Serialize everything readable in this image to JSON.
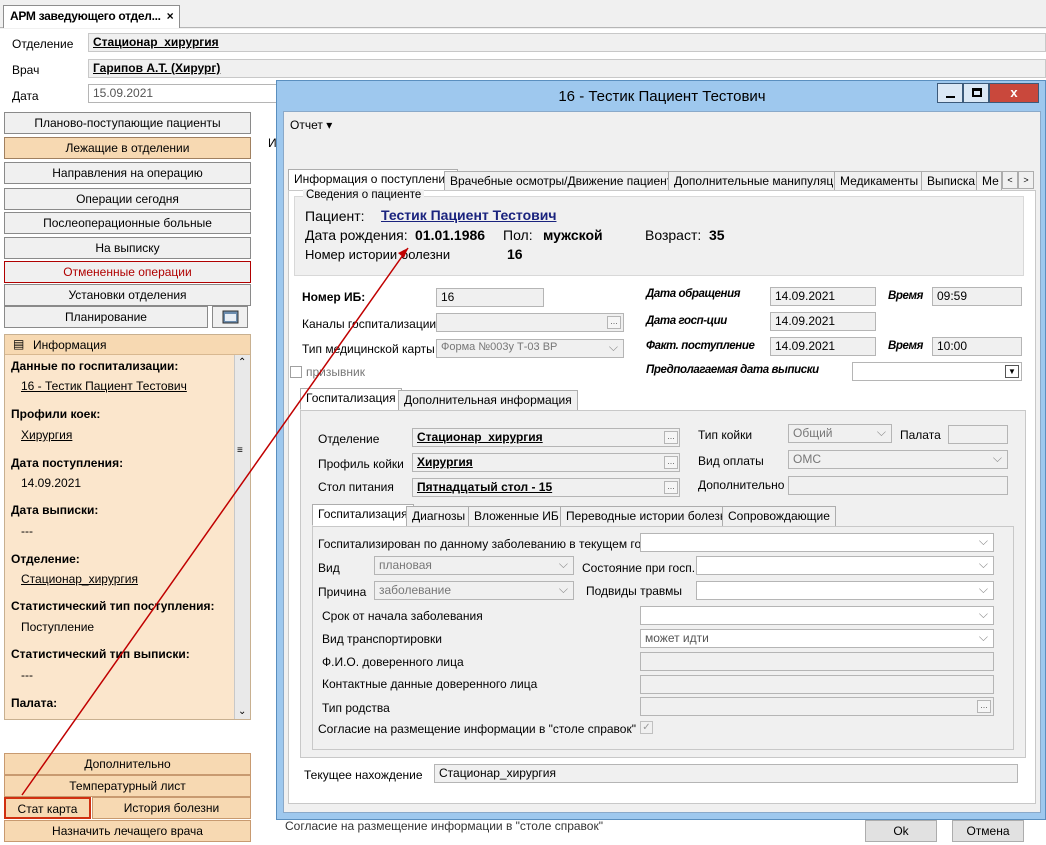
{
  "app_tab": {
    "title": "АРМ заведующего отдел...",
    "close": "×"
  },
  "header": {
    "department_label": "Отделение",
    "department_value": "Стационар_хирургия",
    "doctor_label": "Врач",
    "doctor_value": "Гарипов А.Т. (Хирург)",
    "date_label": "Дата",
    "date_value": "15.09.2021"
  },
  "nav": [
    "Планово-поступающие пациенты",
    "Лежащие в отделении",
    "Направления на операцию",
    "Операции сегодня",
    "Послеоперационные больные",
    "На выписку",
    "Отмененные операции",
    "Установки отделения",
    "Планирование"
  ],
  "info_panel": {
    "title": "Информация",
    "items": [
      {
        "h": "Данные по госпитализации:",
        "v": "16 - Тестик Пациент Тестович"
      },
      {
        "h": "Профили коек:",
        "v": "Хирургия"
      },
      {
        "h": "Дата поступления:",
        "v": "14.09.2021"
      },
      {
        "h": "Дата выписки:",
        "v": "---"
      },
      {
        "h": "Отделение:",
        "v": "Стационар_хирургия"
      },
      {
        "h": "Статистический тип поступления:",
        "v": "Поступление"
      },
      {
        "h": "Статистический тип выписки:",
        "v": "---"
      },
      {
        "h": "Палата:",
        "v": ""
      }
    ]
  },
  "bottom_buttons": {
    "additional": "Дополнительно",
    "temp_sheet": "Температурный лист",
    "stat_card": "Стат карта",
    "history": "История болезни",
    "assign_doctor": "Назначить лечащего врача"
  },
  "bg_text": {
    "col_header": "И",
    "consent_bg": "Согласие на размещение информации в \"столе справок\""
  },
  "dialog": {
    "title": "16 - Тестик Пациент Тестович",
    "menu_report": "Отчет ▾",
    "tabs": [
      "Информация о поступлении",
      "Врачебные осмотры/Движение пациента",
      "Дополнительные манипуляции",
      "Медикаменты",
      "Выписка",
      "Ме"
    ],
    "patient_section": "Сведения о пациенте",
    "patient_label": "Пациент:",
    "patient_name": "Тестик Пациент Тестович",
    "dob_label": "Дата рождения:",
    "dob": "01.01.1986",
    "sex_label": "Пол:",
    "sex": "мужской",
    "age_label": "Возраст:",
    "age": "35",
    "history_label": "Номер истории болезни",
    "history": "16",
    "ib_label": "Номер ИБ:",
    "ib": "16",
    "channels_label": "Каналы госпитализации",
    "card_type_label": "Тип медицинской карты",
    "card_type": "Форма №003у Т-03 ВР",
    "conscript_label": "призывник",
    "appeal_date_label": "Дата обращения",
    "appeal_date": "14.09.2021",
    "time_label": "Время",
    "appeal_time": "09:59",
    "hosp_date_label": "Дата госп-ции",
    "hosp_date": "14.09.2021",
    "fact_label": "Факт. поступление",
    "fact_date": "14.09.2021",
    "fact_time": "10:00",
    "discharge_label": "Предполагаемая дата выписки",
    "subtabs": [
      "Госпитализация",
      "Дополнительная информация"
    ],
    "dept_label": "Отделение",
    "dept": "Стационар_хирургия",
    "bed_profile_label": "Профиль койки",
    "bed_profile": "Хирургия",
    "diet_label": "Стол питания",
    "diet": "Пятнадцатый стол - 15",
    "bed_type_label": "Тип койки",
    "bed_type": "Общий",
    "ward_label": "Палата",
    "payment_label": "Вид оплаты",
    "payment": "ОМС",
    "extra_label": "Дополнительно",
    "inner_tabs": [
      "Госпитализация",
      "Диагнозы",
      "Вложенные ИБ",
      "Переводные истории болезни",
      "Сопровождающие"
    ],
    "hosp_year_label": "Госпитализирован по данному заболеванию в текущем году",
    "kind_label": "Вид",
    "kind": "плановая",
    "state_label": "Состояние при госп.",
    "reason_label": "Причина",
    "reason": "заболевание",
    "trauma_label": "Подвиды травмы",
    "onset_label": "Срок от начала заболевания",
    "transport_label": "Вид транспортировки",
    "transport": "может идти",
    "trusted_label": "Ф.И.О. доверенного лица",
    "trusted_contacts_label": "Контактные данные доверенного лица",
    "kinship_label": "Тип родства",
    "consent_label": "Согласие на размещение информации в \"столе справок\"",
    "current_label": "Текущее нахождение",
    "current": "Стационар_хирургия",
    "ok": "Ok",
    "cancel": "Отмена"
  }
}
